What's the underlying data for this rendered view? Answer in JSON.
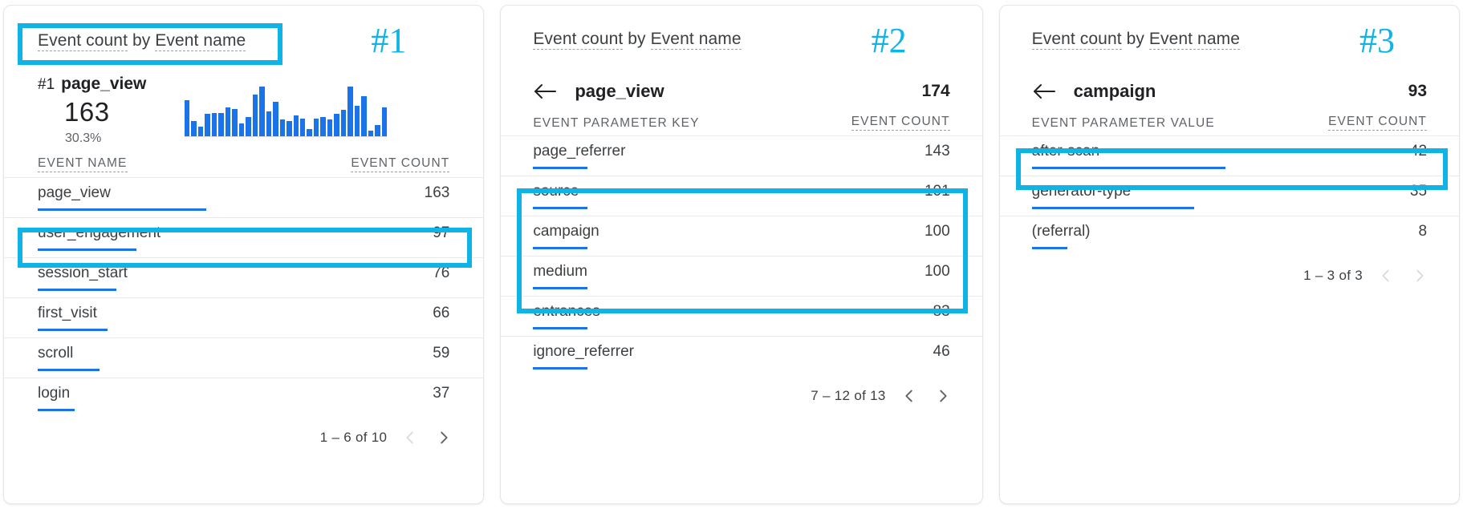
{
  "accent_cyan": "#10b3e6",
  "bar_blue": "#1a73e8",
  "panels": [
    {
      "rank_label": "#1",
      "title_part_1": "Event count",
      "title_by": " by ",
      "title_part_2": "Event name",
      "summary": {
        "rank": "#1",
        "event_name": "page_view",
        "value": "163",
        "percent": "30.3%"
      },
      "columns": {
        "left": "EVENT NAME",
        "right": "EVENT COUNT"
      },
      "rows": [
        {
          "label": "page_view",
          "value": "163",
          "bar_pct": 41
        },
        {
          "label": "user_engagement",
          "value": "97",
          "bar_pct": 24
        },
        {
          "label": "session_start",
          "value": "76",
          "bar_pct": 19
        },
        {
          "label": "first_visit",
          "value": "66",
          "bar_pct": 17
        },
        {
          "label": "scroll",
          "value": "59",
          "bar_pct": 15
        },
        {
          "label": "login",
          "value": "37",
          "bar_pct": 9
        }
      ],
      "pager": {
        "range": "1 – 6 of 10",
        "prev_enabled": false,
        "next_enabled": true
      }
    },
    {
      "rank_label": "#2",
      "title_part_1": "Event count",
      "title_by": " by ",
      "title_part_2": "Event name",
      "drill": {
        "name": "page_view",
        "total": "174"
      },
      "columns": {
        "left": "EVENT PARAMETER KEY",
        "right": "EVENT COUNT"
      },
      "rows": [
        {
          "label": "page_referrer",
          "value": "143",
          "bar_pct": 13
        },
        {
          "label": "source",
          "value": "101",
          "bar_pct": 13
        },
        {
          "label": "campaign",
          "value": "100",
          "bar_pct": 13
        },
        {
          "label": "medium",
          "value": "100",
          "bar_pct": 13
        },
        {
          "label": "entrances",
          "value": "83",
          "bar_pct": 13
        },
        {
          "label": "ignore_referrer",
          "value": "46",
          "bar_pct": 13
        }
      ],
      "pager": {
        "range": "7 – 12 of 13",
        "prev_enabled": true,
        "next_enabled": true
      }
    },
    {
      "rank_label": "#3",
      "title_part_1": "Event count",
      "title_by": " by ",
      "title_part_2": "Event name",
      "drill": {
        "name": "campaign",
        "total": "93"
      },
      "columns": {
        "left": "EVENT PARAMETER VALUE",
        "right": "EVENT COUNT"
      },
      "rows": [
        {
          "label": "after-scan",
          "value": "42",
          "bar_pct": 49
        },
        {
          "label": "generator-type",
          "value": "35",
          "bar_pct": 41
        },
        {
          "label": "(referral)",
          "value": "8",
          "bar_pct": 9
        }
      ],
      "pager": {
        "range": "1 – 3 of 3",
        "prev_enabled": false,
        "next_enabled": false
      }
    }
  ],
  "chart_data": {
    "type": "bar",
    "title": "Event count by Event name — page_view sparkline",
    "xlabel": "",
    "ylabel": "Event count",
    "grid": false,
    "legend": "none",
    "values": [
      52,
      22,
      14,
      32,
      34,
      34,
      42,
      40,
      18,
      28,
      60,
      72,
      36,
      50,
      24,
      22,
      30,
      26,
      10,
      26,
      28,
      24,
      32,
      38,
      72,
      44,
      58,
      8,
      16,
      42
    ]
  }
}
